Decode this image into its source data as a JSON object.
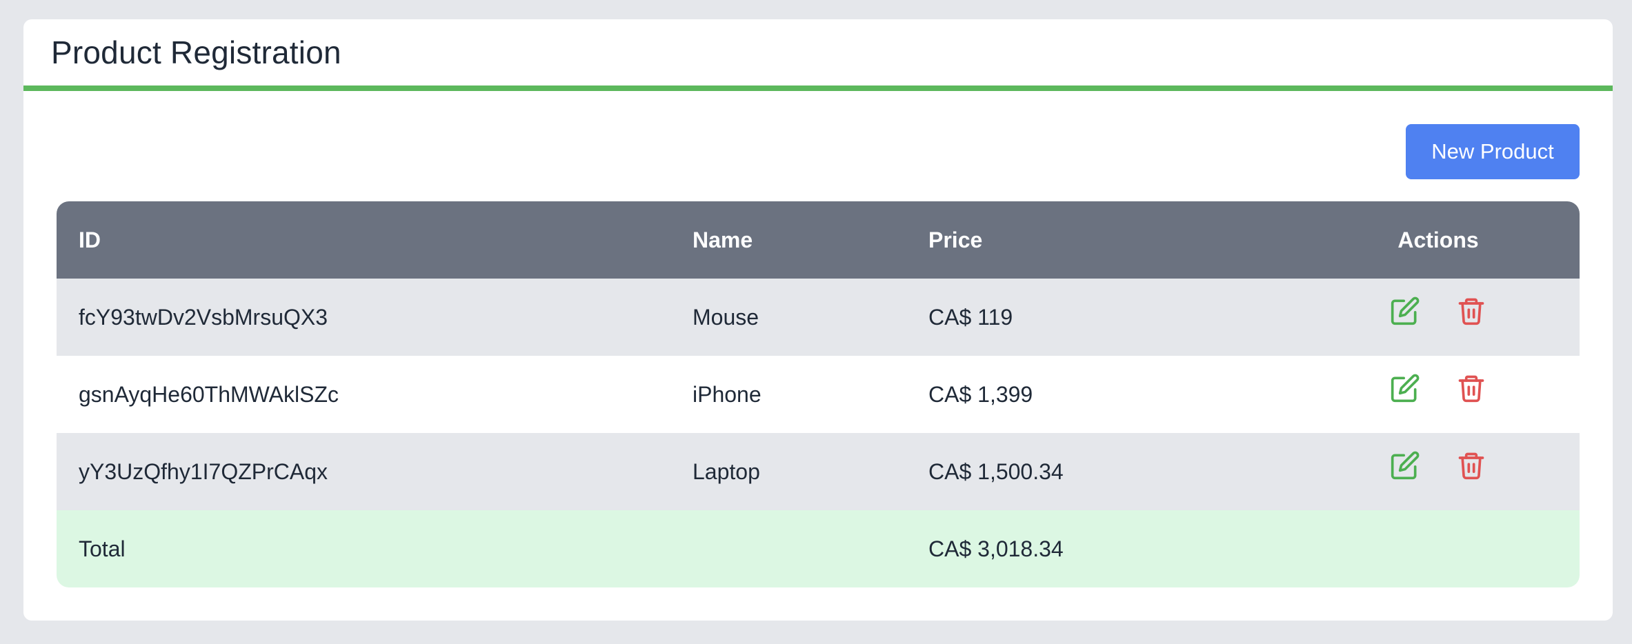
{
  "page": {
    "title": "Product Registration"
  },
  "toolbar": {
    "new_label": "New Product"
  },
  "table": {
    "headers": {
      "id": "ID",
      "name": "Name",
      "price": "Price",
      "actions": "Actions"
    },
    "rows": [
      {
        "id": "fcY93twDv2VsbMrsuQX3",
        "name": "Mouse",
        "price": "CA$ 119"
      },
      {
        "id": "gsnAyqHe60ThMWAklSZc",
        "name": "iPhone",
        "price": "CA$ 1,399"
      },
      {
        "id": "yY3UzQfhy1I7QZPrCAqx",
        "name": "Laptop",
        "price": "CA$ 1,500.34"
      }
    ],
    "total": {
      "label": "Total",
      "price": "CA$ 3,018.34"
    }
  },
  "icons": {
    "edit": "edit-icon",
    "delete": "trash-icon"
  },
  "colors": {
    "header_underline": "#5cb85c",
    "primary_button": "#4f81f1",
    "table_header": "#6b7280",
    "edit_icon": "#4caf50",
    "delete_icon": "#e05252",
    "total_row": "#dcf7e3"
  }
}
